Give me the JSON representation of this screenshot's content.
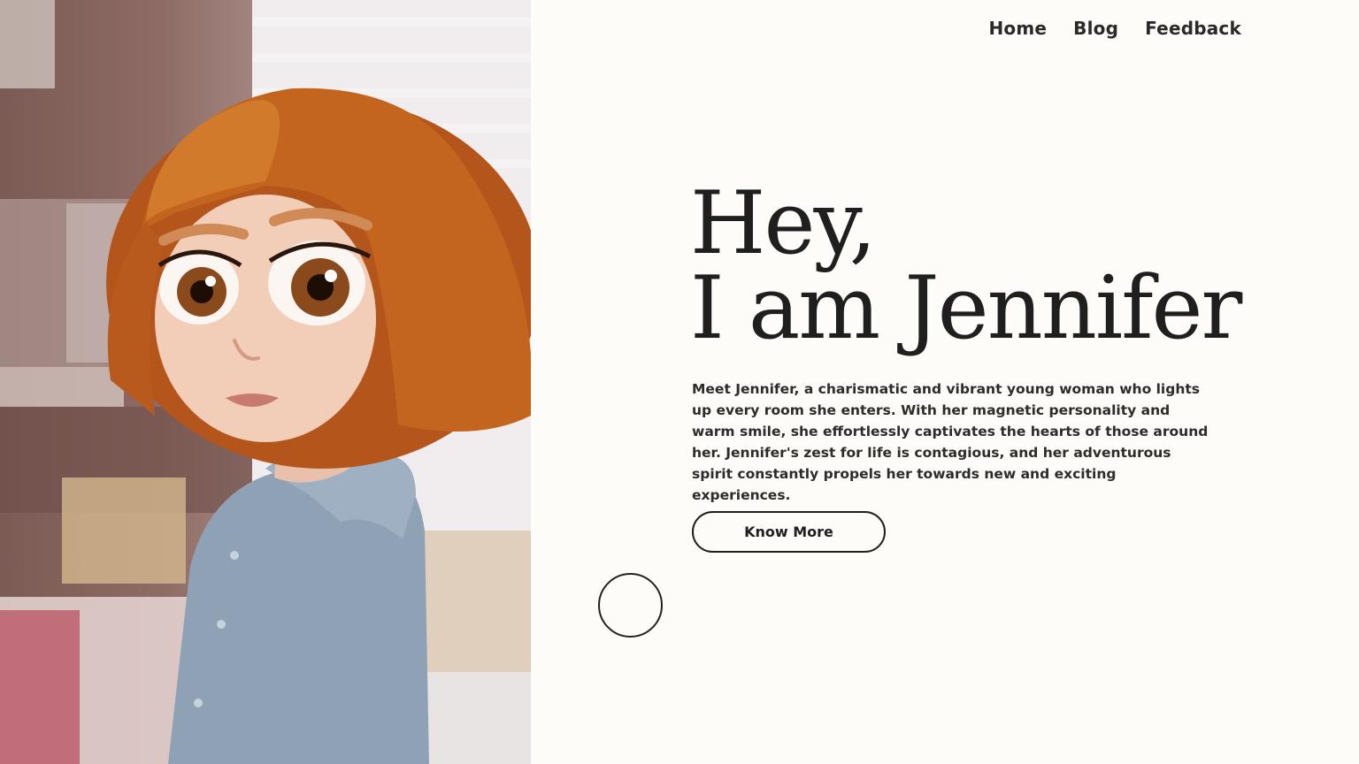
{
  "nav": {
    "items": [
      {
        "label": "Home"
      },
      {
        "label": "Blog"
      },
      {
        "label": "Feedback"
      }
    ]
  },
  "hero": {
    "heading_line1": "Hey,",
    "heading_line2": "I am Jennifer",
    "description": "Meet Jennifer, a charismatic and vibrant young woman who lights up every room she enters. With her magnetic personality and warm smile, she effortlessly captivates the hearts of those around her. Jennifer's zest for life is contagious, and her adventurous spirit constantly propels her towards new and exciting experiences.",
    "button_label": "Know More",
    "image_alt": "3D illustrated girl with copper bob haircut and blue coat"
  },
  "colors": {
    "background": "#fdfcf8",
    "text": "#1f1f1f",
    "hair": "#c0621f",
    "coat": "#8ea0b3"
  }
}
